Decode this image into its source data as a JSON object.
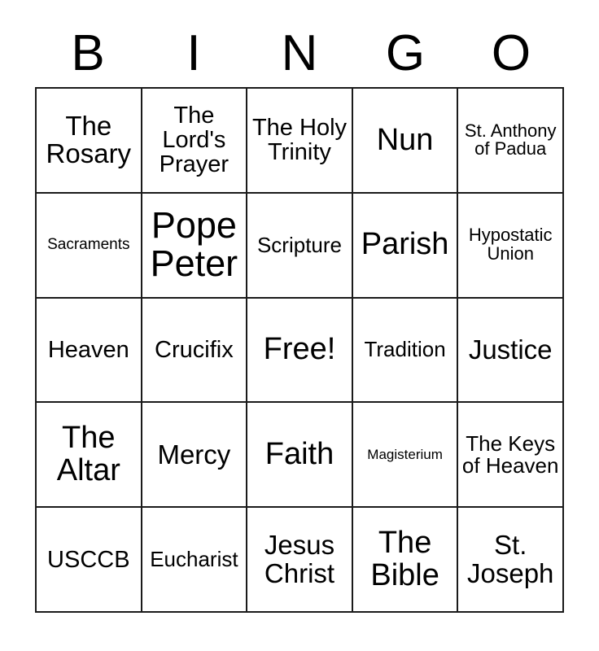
{
  "card": {
    "title": "BINGO",
    "header_letters": [
      "B",
      "I",
      "N",
      "G",
      "O"
    ],
    "free_space_label": "Free!",
    "border_color": "#1a1a1a",
    "background_color": "#ffffff",
    "text_color": "#000000",
    "rows": 5,
    "columns": 5
  },
  "cells": [
    {
      "text": "The Rosary",
      "size": "fs-l"
    },
    {
      "text": "The Lord's Prayer",
      "size": "fs-ml"
    },
    {
      "text": "The Holy Trinity",
      "size": "fs-ml"
    },
    {
      "text": "Nun",
      "size": "fs-xl"
    },
    {
      "text": "St. Anthony of Padua",
      "size": "fs-sm"
    },
    {
      "text": "Sacraments",
      "size": "fs-s"
    },
    {
      "text": "Pope Peter",
      "size": "fs-xxl"
    },
    {
      "text": "Scripture",
      "size": "fs-m"
    },
    {
      "text": "Parish",
      "size": "fs-xl"
    },
    {
      "text": "Hypostatic Union",
      "size": "fs-sm"
    },
    {
      "text": "Heaven",
      "size": "fs-ml"
    },
    {
      "text": "Crucifix",
      "size": "fs-ml"
    },
    {
      "text": "Free!",
      "size": "fs-xl"
    },
    {
      "text": "Tradition",
      "size": "fs-m"
    },
    {
      "text": "Justice",
      "size": "fs-l"
    },
    {
      "text": "The Altar",
      "size": "fs-xl"
    },
    {
      "text": "Mercy",
      "size": "fs-l"
    },
    {
      "text": "Faith",
      "size": "fs-xl"
    },
    {
      "text": "Magisterium",
      "size": "fs-xs"
    },
    {
      "text": "The Keys of Heaven",
      "size": "fs-m"
    },
    {
      "text": "USCCB",
      "size": "fs-ml"
    },
    {
      "text": "Eucharist",
      "size": "fs-m"
    },
    {
      "text": "Jesus Christ",
      "size": "fs-l"
    },
    {
      "text": "The Bible",
      "size": "fs-xl"
    },
    {
      "text": "St. Joseph",
      "size": "fs-l"
    }
  ]
}
